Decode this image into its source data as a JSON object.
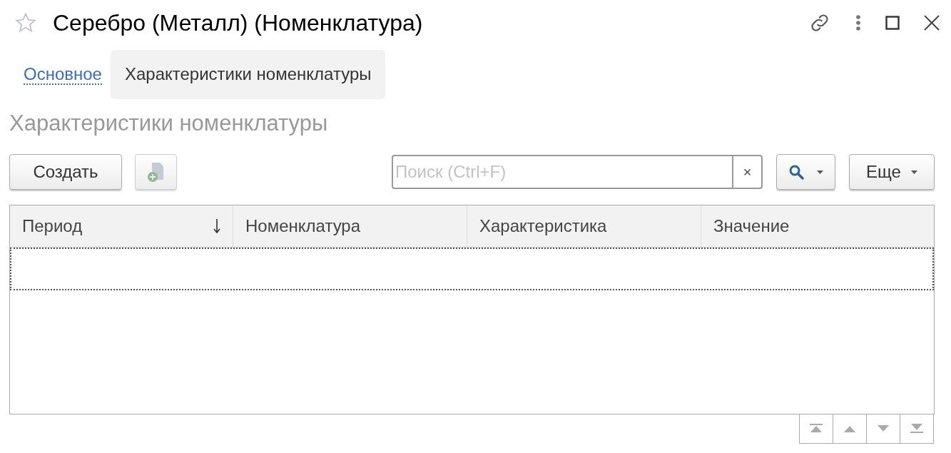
{
  "window": {
    "title": "Серебро (Металл) (Номенклатура)"
  },
  "tabs": [
    {
      "label": "Основное",
      "selected": false
    },
    {
      "label": "Характеристики номенклатуры",
      "selected": true
    }
  ],
  "section_title": "Характеристики номенклатуры",
  "toolbar": {
    "create_button": "Создать",
    "search": {
      "placeholder": "Поиск (Ctrl+F)",
      "clear": "×"
    },
    "more_button": "Еще"
  },
  "table": {
    "columns": [
      {
        "label": "Период",
        "sorted": true
      },
      {
        "label": "Номенклатура",
        "sorted": false
      },
      {
        "label": "Характеристика",
        "sorted": false
      },
      {
        "label": "Значение",
        "sorted": false
      }
    ],
    "rows": [
      {
        "selected": true
      }
    ]
  }
}
